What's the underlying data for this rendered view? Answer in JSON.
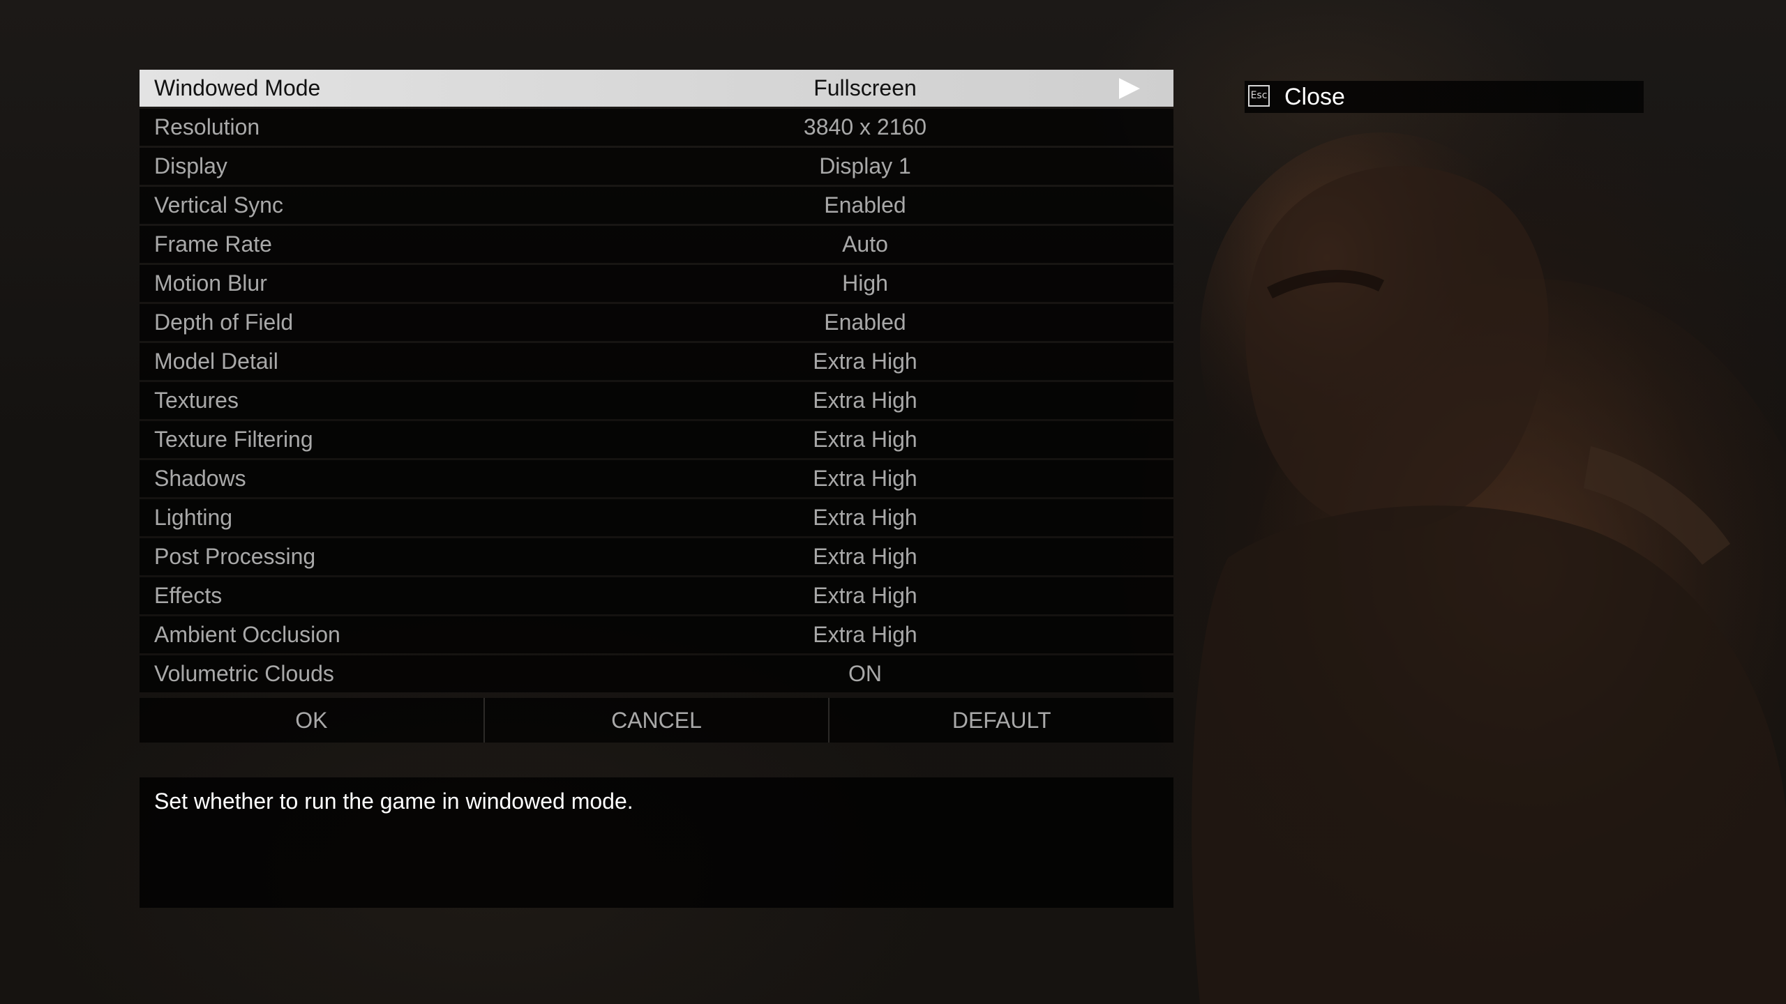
{
  "settings": [
    {
      "label": "Windowed Mode",
      "value": "Fullscreen"
    },
    {
      "label": "Resolution",
      "value": "3840 x 2160"
    },
    {
      "label": "Display",
      "value": "Display 1"
    },
    {
      "label": "Vertical Sync",
      "value": "Enabled"
    },
    {
      "label": "Frame Rate",
      "value": "Auto"
    },
    {
      "label": "Motion Blur",
      "value": "High"
    },
    {
      "label": "Depth of Field",
      "value": "Enabled"
    },
    {
      "label": "Model Detail",
      "value": "Extra High"
    },
    {
      "label": "Textures",
      "value": "Extra High"
    },
    {
      "label": "Texture Filtering",
      "value": "Extra High"
    },
    {
      "label": "Shadows",
      "value": "Extra High"
    },
    {
      "label": "Lighting",
      "value": "Extra High"
    },
    {
      "label": "Post Processing",
      "value": "Extra High"
    },
    {
      "label": "Effects",
      "value": "Extra High"
    },
    {
      "label": "Ambient Occlusion",
      "value": "Extra High"
    },
    {
      "label": "Volumetric Clouds",
      "value": "ON"
    }
  ],
  "selected_index": 0,
  "buttons": {
    "ok": "OK",
    "cancel": "CANCEL",
    "default": "DEFAULT"
  },
  "description": "Set whether to run the game in windowed mode.",
  "close": {
    "key_label": "Esc",
    "label": "Close"
  },
  "icons": {
    "selected_row_arrow": "arrow-right-icon",
    "close_key": "esc-key-icon"
  },
  "colors": {
    "selected_row_bg": "#e3e3e3",
    "row_bg": "#000000",
    "row_text": "#a9a9a9",
    "selected_text": "#111111",
    "highlight_text": "#ffffff"
  }
}
